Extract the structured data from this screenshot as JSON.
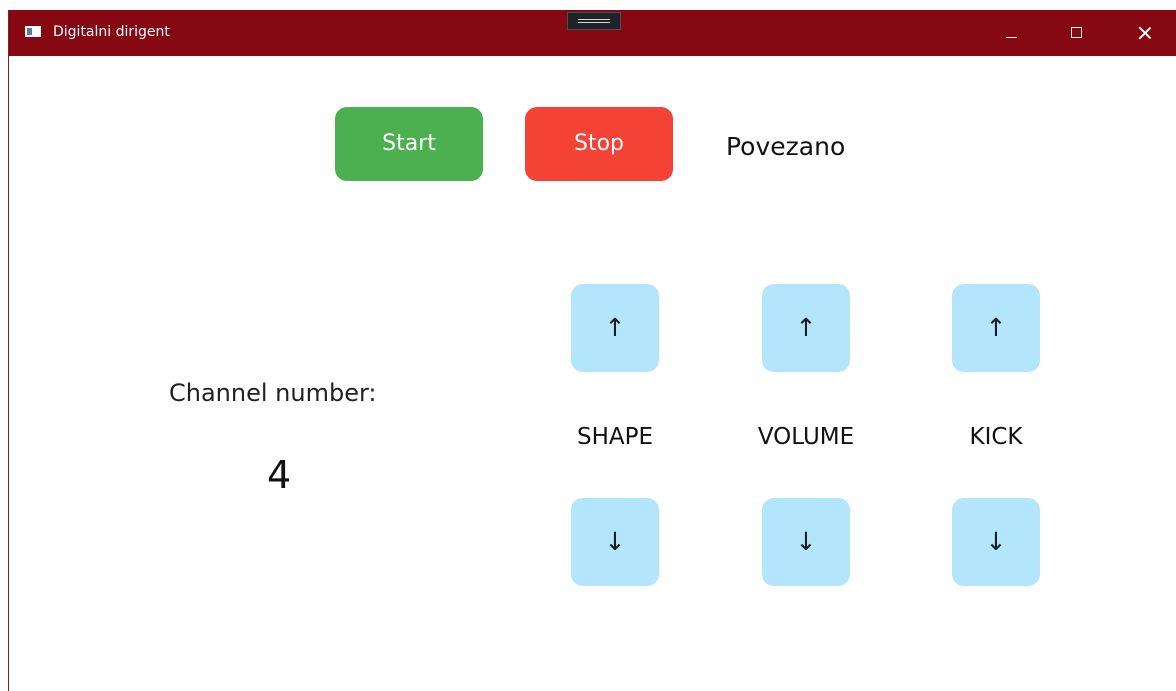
{
  "window": {
    "title": "Digitalni dirigent",
    "icons": {
      "app": "app-window-icon",
      "drag": "drag-handle-icon",
      "minimize": "minimize-icon",
      "maximize": "maximize-icon",
      "close": "close-icon"
    },
    "colors": {
      "titlebar": "#860813",
      "start": "#4caf50",
      "stop": "#f44336",
      "arrow_button": "#b3e5fc"
    }
  },
  "toolbar": {
    "start_label": "Start",
    "stop_label": "Stop",
    "connection_status": "Povezano"
  },
  "channel": {
    "label": "Channel number:",
    "value": "4"
  },
  "controls": [
    {
      "label": "SHAPE",
      "up_symbol": "↑",
      "down_symbol": "↓"
    },
    {
      "label": "VOLUME",
      "up_symbol": "↑",
      "down_symbol": "↓"
    },
    {
      "label": "KICK",
      "up_symbol": "↑",
      "down_symbol": "↓"
    }
  ]
}
